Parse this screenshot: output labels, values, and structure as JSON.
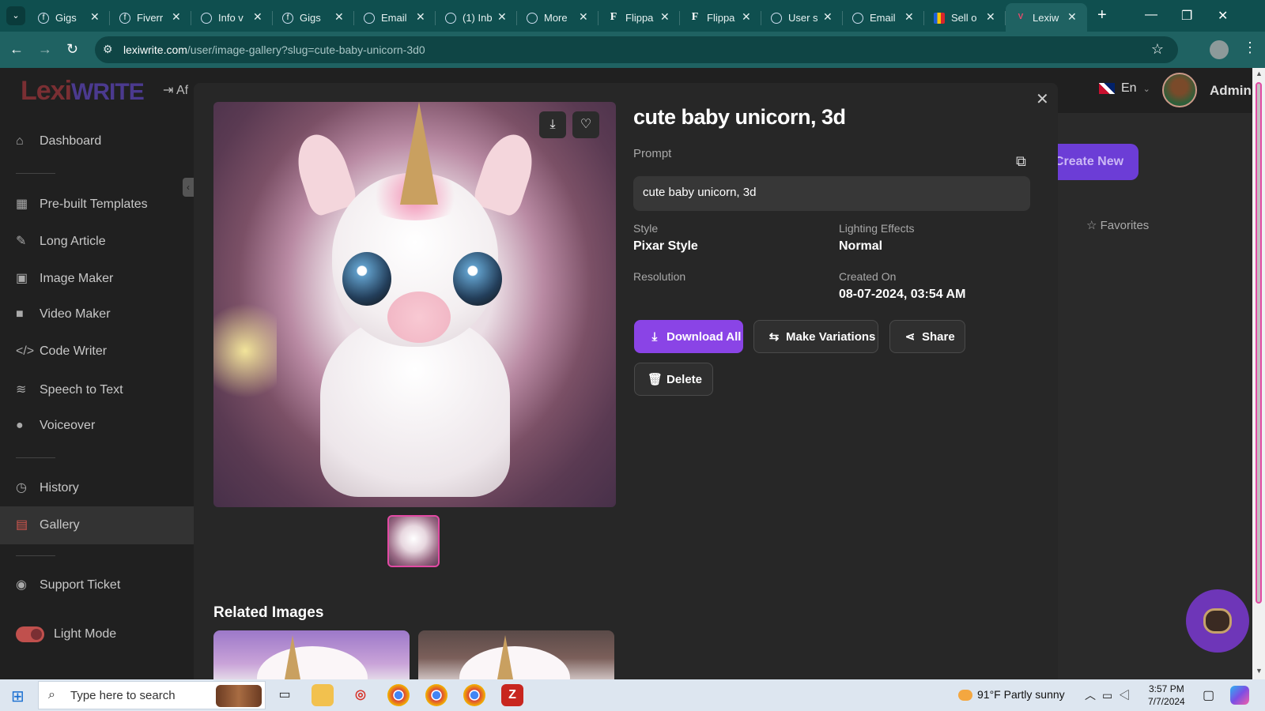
{
  "browser": {
    "tabs": [
      {
        "title": "Gigs",
        "icon": "fiverr-icon"
      },
      {
        "title": "Fiverr",
        "icon": "fiverr-icon"
      },
      {
        "title": "Info v",
        "icon": "web-icon"
      },
      {
        "title": "Gigs",
        "icon": "fiverr-icon"
      },
      {
        "title": "Email",
        "icon": "globe-icon"
      },
      {
        "title": "(1) Inb",
        "icon": "globe-icon"
      },
      {
        "title": "More",
        "icon": "globe-icon"
      },
      {
        "title": "Flippa",
        "icon": "flippa-icon"
      },
      {
        "title": "Flippa",
        "icon": "flippa-icon"
      },
      {
        "title": "User s",
        "icon": "loading-icon"
      },
      {
        "title": "Email",
        "icon": "globe-icon"
      },
      {
        "title": "Sell o",
        "icon": "store-icon"
      },
      {
        "title": "Lexiw",
        "icon": "lexiwrite-icon"
      }
    ],
    "url_host": "lexiwrite.com",
    "url_path": "/user/image-gallery?slug=cute-baby-unicorn-3d0"
  },
  "app": {
    "logo_part1": "Lexi",
    "logo_part2": "WRITE",
    "affiliate_label": "Af",
    "language": "En",
    "user_name": "Admin",
    "sidebar": [
      {
        "label": "Dashboard",
        "icon": "home-icon"
      },
      {
        "label": "Pre-built Templates",
        "icon": "grid-icon"
      },
      {
        "label": "Long Article",
        "icon": "pen-icon"
      },
      {
        "label": "Image Maker",
        "icon": "image-icon"
      },
      {
        "label": "Video Maker",
        "icon": "video-icon"
      },
      {
        "label": "Code Writer",
        "icon": "code-icon"
      },
      {
        "label": "Speech to Text",
        "icon": "waveform-icon"
      },
      {
        "label": "Voiceover",
        "icon": "mic-icon"
      },
      {
        "label": "History",
        "icon": "history-icon"
      },
      {
        "label": "Gallery",
        "icon": "gallery-icon"
      },
      {
        "label": "Support Ticket",
        "icon": "support-icon"
      },
      {
        "label": "Light Mode",
        "icon": "toggle-icon"
      }
    ],
    "background_create_label": "Create New",
    "background_favorites_label": "Favorites",
    "background_partial_tab": "s"
  },
  "modal": {
    "title": "cute baby unicorn, 3d",
    "prompt_label": "Prompt",
    "prompt_value": "cute baby unicorn, 3d",
    "style_label": "Style",
    "style_value": "Pixar Style",
    "lighting_label": "Lighting Effects",
    "lighting_value": "Normal",
    "resolution_label": "Resolution",
    "created_label": "Created On",
    "created_value": "08-07-2024, 03:54 AM",
    "buttons": {
      "download_all": "Download All",
      "make_variations": "Make Variations",
      "share": "Share",
      "delete": "Delete"
    },
    "related_title": "Related Images"
  },
  "taskbar": {
    "search_placeholder": "Type here to search",
    "weather": "91°F  Partly sunny",
    "time": "3:57 PM",
    "date": "7/7/2024"
  }
}
